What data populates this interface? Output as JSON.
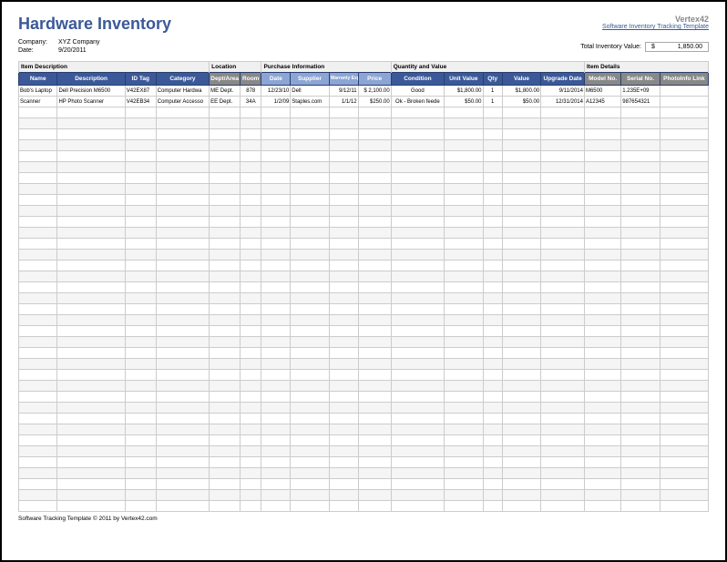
{
  "title": "Hardware Inventory",
  "brand": {
    "name": "Vertex42",
    "link": "Software Inventory Tracking Template"
  },
  "meta": {
    "company_label": "Company:",
    "company_value": "XYZ Company",
    "date_label": "Date:",
    "date_value": "9/20/2011",
    "total_label": "Total Inventory Value:",
    "total_currency": "$",
    "total_value": "1,850.00"
  },
  "groups": {
    "item_desc": "Item Description",
    "location": "Location",
    "purchase": "Purchase Information",
    "quantity": "Quantity and Value",
    "details": "Item Details"
  },
  "columns": {
    "name": "Name",
    "description": "Description",
    "id_tag": "ID Tag",
    "category": "Category",
    "dept": "Dept/Area",
    "room": "Room",
    "pdate": "Date",
    "supplier": "Supplier",
    "warranty": "Warranty Expiration",
    "price": "Price",
    "condition": "Condition",
    "unit_value": "Unit Value",
    "qty": "Qty",
    "value": "Value",
    "upgrade": "Upgrade Date",
    "model": "Model No.",
    "serial": "Serial No.",
    "photo": "PhotoInfo Link"
  },
  "rows": [
    {
      "name": "Bob's Laptop",
      "description": "Dell Precision M6500",
      "id_tag": "V42EX87",
      "category": "Computer Hardwa",
      "dept": "ME Dept.",
      "room": "878",
      "pdate": "12/23/10",
      "supplier": "Dell",
      "warranty": "9/12/11",
      "price": "$ 2,100.00",
      "condition": "Good",
      "unit_value": "$1,800.00",
      "qty": "1",
      "value": "$1,800.00",
      "upgrade": "9/11/2014",
      "model": "M6500",
      "serial": "1.235E+09",
      "photo": ""
    },
    {
      "name": "Scanner",
      "description": "HP Photo Scanner",
      "id_tag": "V42EB34",
      "category": "Computer Accesso",
      "dept": "EE Dept.",
      "room": "34A",
      "pdate": "1/2/09",
      "supplier": "Staples.com",
      "warranty": "1/1/12",
      "price": "$250.00",
      "condition": "Ok - Broken feede",
      "unit_value": "$50.00",
      "qty": "1",
      "value": "$50.00",
      "upgrade": "12/31/2014",
      "model": "A12345",
      "serial": "987654321",
      "photo": ""
    }
  ],
  "empty_rows": 37,
  "footer": "Software Tracking Template © 2011 by Vertex42.com"
}
